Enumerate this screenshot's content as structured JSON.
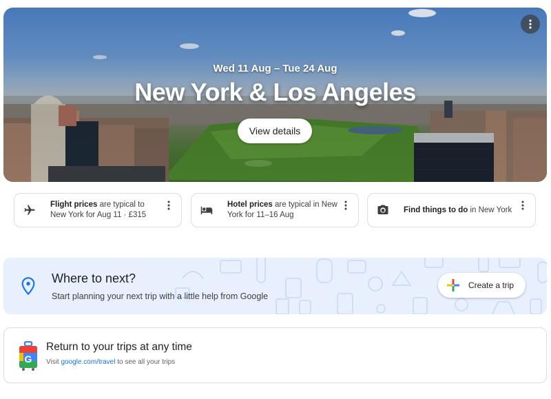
{
  "hero": {
    "dates": "Wed 11 Aug – Tue 24 Aug",
    "title": "New York & Los Angeles",
    "button_label": "View details",
    "more_icon": "more-vert-icon"
  },
  "cards": [
    {
      "icon": "airplane-icon",
      "bold": "Flight prices",
      "text": " are typical to New York for Aug 11 · £315"
    },
    {
      "icon": "bed-icon",
      "bold": "Hotel prices",
      "text": " are typical in New York for 11–16 Aug"
    },
    {
      "icon": "camera-icon",
      "bold": "Find things to do",
      "text": " in New York"
    }
  ],
  "next": {
    "title": "Where to next?",
    "subtitle": "Start planning your next trip with a little help from Google",
    "button_label": "Create a trip",
    "pin_color": "#1a73e8"
  },
  "return_card": {
    "title": "Return to your trips at any time",
    "sub_prefix": "Visit ",
    "link": "google.com/travel",
    "sub_suffix": " to see all your trips"
  },
  "colors": {
    "accent_blue": "#1a73e8",
    "google_red": "#ea4335",
    "google_yellow": "#fbbc04",
    "google_green": "#34a853",
    "banner_bg": "#e8f0fe"
  }
}
